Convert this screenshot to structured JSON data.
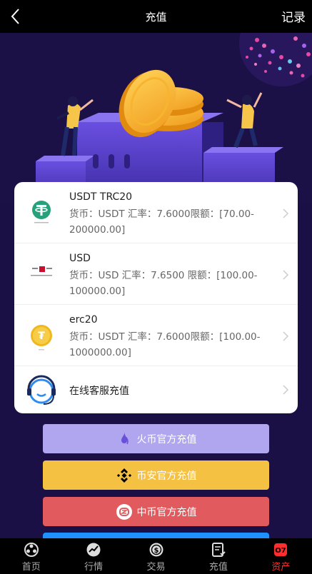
{
  "header": {
    "title": "充值",
    "record_label": "记录"
  },
  "channels": [
    {
      "title": "USDT TRC20",
      "desc": "货币：USDT 汇率：7.6000限额：[70.00-200000.00]",
      "icon": "tether-icon"
    },
    {
      "title": "USD",
      "desc": "货币：USD 汇率：7.6500 限额：[100.00-100000.00]",
      "icon": "east-west-bank-icon"
    },
    {
      "title": "erc20",
      "desc": "货币：USDT 汇率：7.6000限额：[100.00-1000000.00]",
      "icon": "gold-coin-icon"
    },
    {
      "title": "在线客服充值",
      "icon": "headset-icon"
    }
  ],
  "buttons": [
    {
      "label": "火币官方充值",
      "color": "#b0a6ef",
      "icon": "huobi-flame-icon"
    },
    {
      "label": "币安官方充值",
      "color": "#f5c142",
      "icon": "binance-icon"
    },
    {
      "label": "中币官方充值",
      "color": "#e05a5e",
      "icon": "zb-icon"
    },
    {
      "label": "",
      "color": "#1e90ff"
    }
  ],
  "tabs": [
    {
      "label": "首页",
      "icon": "home-icon"
    },
    {
      "label": "行情",
      "icon": "market-icon"
    },
    {
      "label": "交易",
      "icon": "trade-icon"
    },
    {
      "label": "充值",
      "icon": "recharge-icon"
    },
    {
      "label": "资产",
      "icon": "assets-icon",
      "active": true
    }
  ],
  "colors": {
    "accent": "#ff2d2d",
    "hero_bg": "#1b1147",
    "card_bg": "#ffffff"
  }
}
